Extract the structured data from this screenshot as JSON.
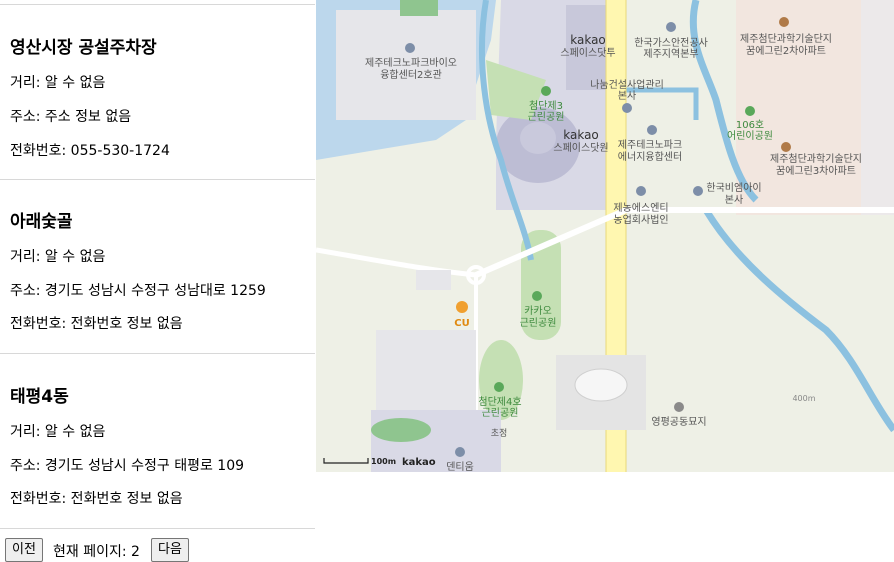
{
  "results": [
    {
      "name": "영산시장 공설주차장",
      "distance": "거리: 알 수 없음",
      "address": "주소: 주소 정보 없음",
      "phone": "전화번호: 055-530-1724"
    },
    {
      "name": "아래숯골",
      "distance": "거리: 알 수 없음",
      "address": "주소: 경기도 성남시 수정구 성남대로 1259",
      "phone": "전화번호: 전화번호 정보 없음"
    },
    {
      "name": "태평4동",
      "distance": "거리: 알 수 없음",
      "address": "주소: 경기도 성남시 수정구 태평로 109",
      "phone": "전화번호: 전화번호 정보 없음"
    }
  ],
  "pager": {
    "prev_label": "이전",
    "page_text": "현재 페이지: 2",
    "next_label": "다음"
  },
  "map": {
    "labels": {
      "jeju_techno_bio": "제주테크노파크바이오",
      "jeju_techno_bio2": "융합센터2호관",
      "kakao_dotu1": "kakao",
      "kakao_dotu2": "스페이스닷투",
      "gas1": "한국가스안전공사",
      "gas2": "제주지역본부",
      "science1": "제주첨단과학기술단지",
      "science2": "꿈에그린2차아파트",
      "nanum1": "나눔건설사업관리",
      "nanum2": "본사",
      "park3_1": "첨단제3",
      "park3_2": "근린공원",
      "kakao_dotone1": "kakao",
      "kakao_dotone2": "스페이스닷원",
      "techno_energy1": "제주테크노파크",
      "techno_energy2": "에너지융합센터",
      "park106_1": "106호",
      "park106_2": "어린이공원",
      "science3_1": "제주첨단과학기술단지",
      "science3_2": "꿈에그린3차아파트",
      "kbio1": "한국비엠아이",
      "kbio2": "본사",
      "jeno1": "제농에스엔티",
      "jeno2": "농업회사법인",
      "kakao_park1": "카카오",
      "kakao_park2": "근린공원",
      "cu": "CU",
      "park4_1": "첨단제4호",
      "park4_2": "근린공원",
      "chojeong": "초정",
      "dentium": "덴티움",
      "yeongpyeong": "영평공동묘지",
      "elev": "400m",
      "scale": "100m",
      "brand": "kakao"
    }
  }
}
